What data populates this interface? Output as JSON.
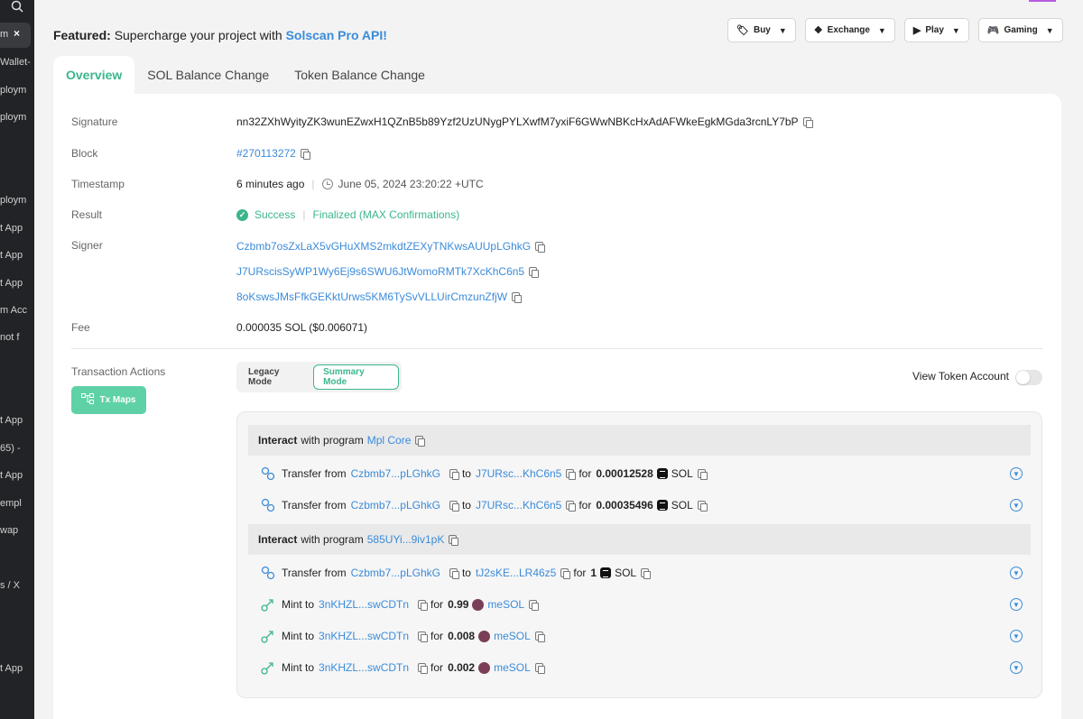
{
  "sidebar": {
    "active_item": "m",
    "close_symbol": "×",
    "items": [
      {
        "label": "Wallet-"
      },
      {
        "label": "ploym"
      },
      {
        "label": "ploym"
      },
      {
        "label": "ploym"
      },
      {
        "label": "t App"
      },
      {
        "label": "t App"
      },
      {
        "label": "t App"
      },
      {
        "label": "m Acc"
      },
      {
        "label": "not f"
      },
      {
        "label": "t App"
      },
      {
        "label": "65) -"
      },
      {
        "label": "t App"
      },
      {
        "label": "empl"
      },
      {
        "label": "wap"
      },
      {
        "label": "s / X"
      },
      {
        "label": "t App"
      }
    ]
  },
  "featured": {
    "prefix": "Featured:",
    "text": "Supercharge your project with",
    "link": "Solscan Pro API!"
  },
  "top_buttons": [
    {
      "label": "Buy",
      "icon": "tag-icon"
    },
    {
      "label": "Exchange",
      "icon": "exchange-icon"
    },
    {
      "label": "Play",
      "icon": "play-icon"
    },
    {
      "label": "Gaming",
      "icon": "gamepad-icon"
    }
  ],
  "tabs": [
    {
      "label": "Overview",
      "active": true
    },
    {
      "label": "SOL Balance Change",
      "active": false
    },
    {
      "label": "Token Balance Change",
      "active": false
    }
  ],
  "details": {
    "signature_label": "Signature",
    "signature": "nn32ZXhWyityZK3wunEZwxH1QZnB5b89Yzf2UzUNygPYLXwfM7yxiF6GWwNBKcHxAdAFWkeEgkMGda3rcnLY7bP",
    "block_label": "Block",
    "block": "#270113272",
    "timestamp_label": "Timestamp",
    "timestamp_relative": "6 minutes ago",
    "timestamp_abs": "June 05, 2024 23:20:22 +UTC",
    "result_label": "Result",
    "result": "Success",
    "finalized": "Finalized (MAX Confirmations)",
    "signer_label": "Signer",
    "signers": [
      "Czbmb7osZxLaX5vGHuXMS2mkdtZEXyTNKwsAUUpLGhkG",
      "J7URscisSyWP1Wy6Ej9s6SWU6JtWomoRMTk7XcKhC6n5",
      "8oKswsJMsFfkGEKktUrws5KM6TySvVLLUirCmzunZfjW"
    ],
    "fee_label": "Fee",
    "fee": "0.000035 SOL ($0.006071)"
  },
  "actions_panel": {
    "label": "Transaction Actions",
    "tx_maps": "Tx Maps",
    "legacy_mode": "Legacy Mode",
    "summary_mode": "Summary Mode",
    "view_token_account": "View Token Account",
    "view_token_account_on": false
  },
  "programs": [
    {
      "interact": "Interact",
      "with_program": "with program",
      "name": "Mpl Core"
    },
    {
      "interact": "Interact",
      "with_program": "with program",
      "name": "585UYi...9iv1pK"
    }
  ],
  "actions": [
    {
      "verb": "Transfer from",
      "from": "Czbmb7...pLGhkG",
      "to_word": "to",
      "to": "J7URsc...KhC6n5",
      "for_word": "for",
      "amount": "0.00012528",
      "token": "SOL"
    },
    {
      "verb": "Transfer from",
      "from": "Czbmb7...pLGhkG",
      "to_word": "to",
      "to": "J7URsc...KhC6n5",
      "for_word": "for",
      "amount": "0.00035496",
      "token": "SOL"
    },
    {
      "verb": "Transfer from",
      "from": "Czbmb7...pLGhkG",
      "to_word": "to",
      "to": "tJ2sKE...LR46z5",
      "for_word": "for",
      "amount": "1",
      "token": "SOL"
    },
    {
      "verb": "Mint to",
      "to": "3nKHZL...swCDTn",
      "for_word": "for",
      "amount": "0.99",
      "token": "meSOL"
    },
    {
      "verb": "Mint to",
      "to": "3nKHZL...swCDTn",
      "for_word": "for",
      "amount": "0.008",
      "token": "meSOL"
    },
    {
      "verb": "Mint to",
      "to": "3nKHZL...swCDTn",
      "for_word": "for",
      "amount": "0.002",
      "token": "meSOL"
    }
  ],
  "colors": {
    "accent_green": "#3bb68c",
    "link_blue": "#3b8bd9"
  }
}
